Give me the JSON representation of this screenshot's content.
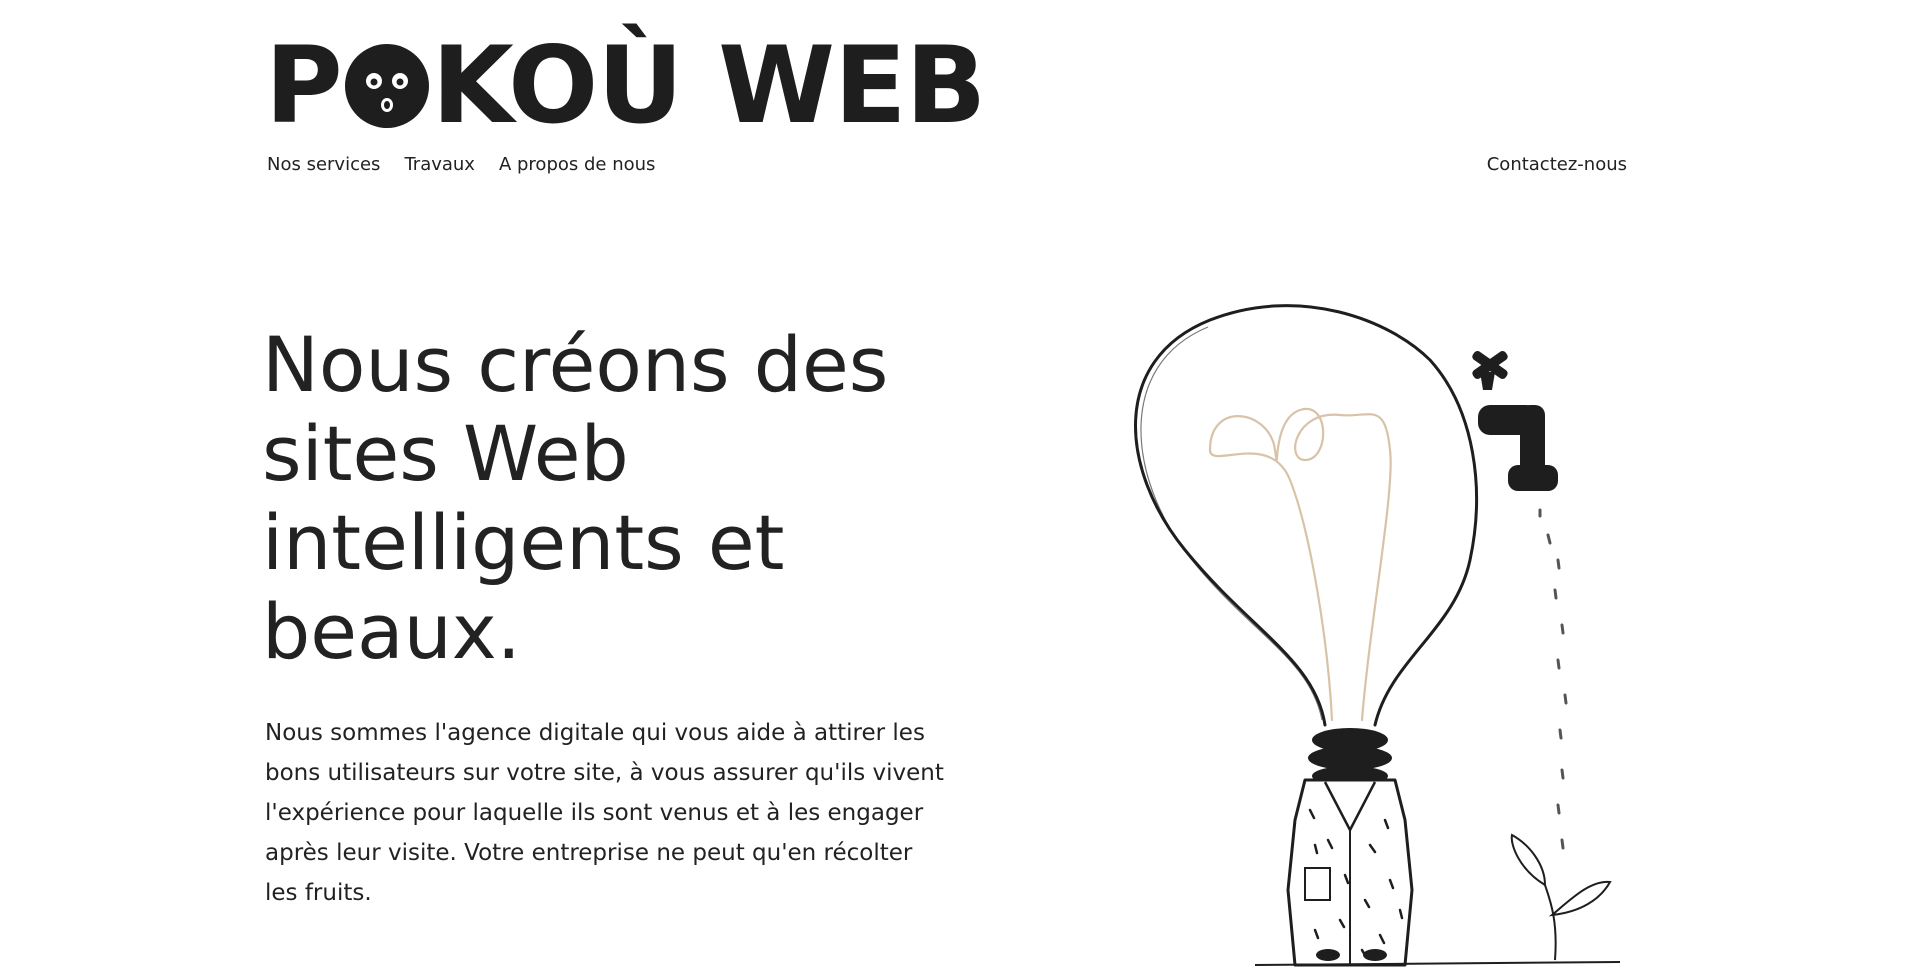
{
  "header": {
    "logo_text_before": "P",
    "logo_text_after": "KOÙ WEB",
    "nav_items": [
      "Nos services",
      "Travaux",
      "A propos de nous"
    ],
    "contact_label": "Contactez-nous"
  },
  "hero": {
    "headline": "Nous créons des sites Web intelligents et beaux.",
    "intro": "Nous sommes l'agence digitale qui vous aide à attirer les bons utilisateurs sur votre site, à vous assurer qu'ils vivent l'expérience pour laquelle ils sont venus et à les engager après leur visite. Votre entreprise ne peut qu'en récolter les fruits."
  },
  "colors": {
    "text": "#222222",
    "background": "#ffffff",
    "filament": "#d8c3a8"
  },
  "icons": {
    "logo_face": "surprised-face-icon",
    "illustration": "lightbulb-character-with-faucet-and-sprout"
  }
}
